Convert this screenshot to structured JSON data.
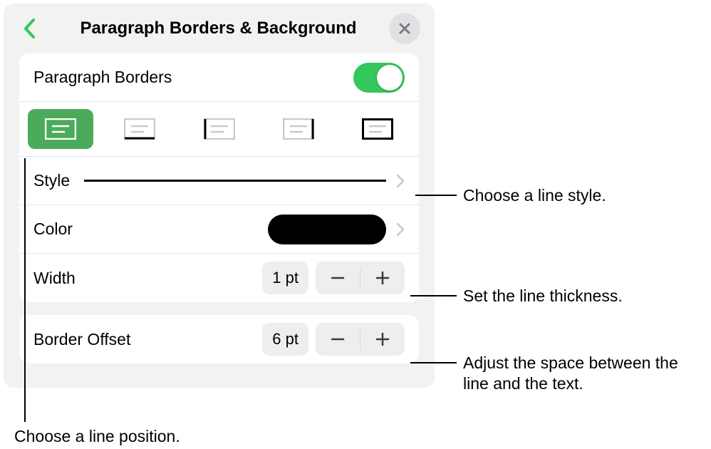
{
  "header": {
    "title": "Paragraph Borders & Background"
  },
  "section1": {
    "toggle_label": "Paragraph Borders",
    "style_label": "Style",
    "color_label": "Color",
    "width_label": "Width",
    "width_value": "1 pt"
  },
  "section2": {
    "offset_label": "Border Offset",
    "offset_value": "6 pt"
  },
  "callouts": {
    "position": "Choose a line position.",
    "style": "Choose a line style.",
    "width": "Set the line thickness.",
    "offset": "Adjust the space between the line and the text."
  }
}
